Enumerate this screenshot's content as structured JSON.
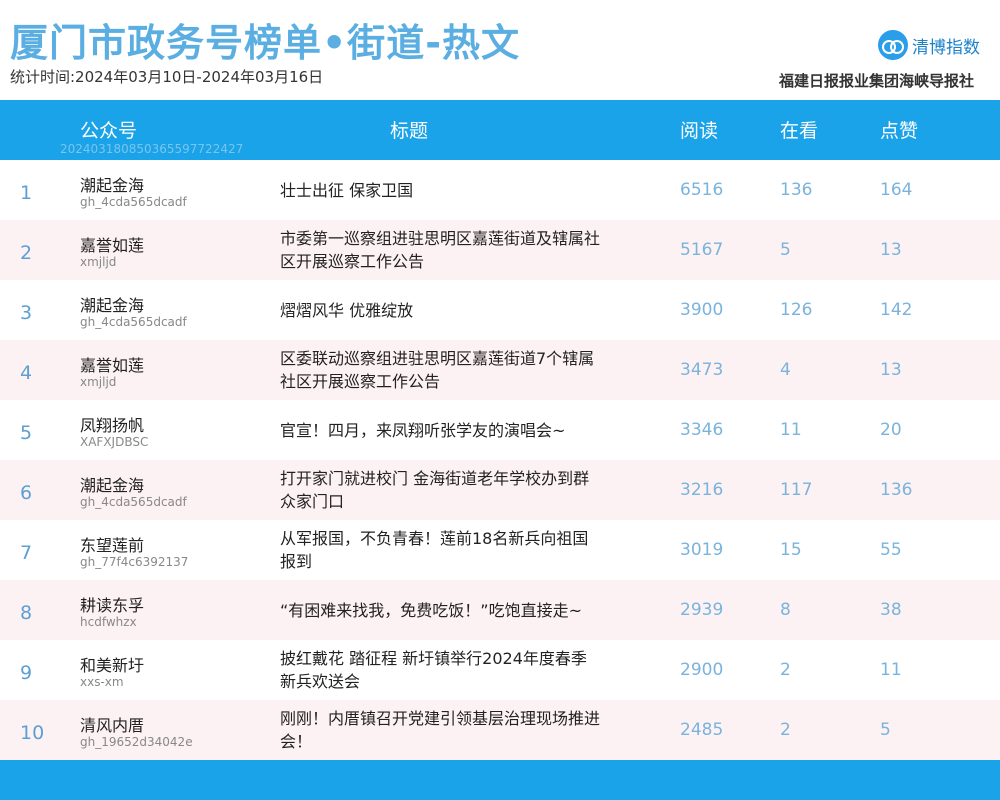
{
  "title": "厦门市政务号榜单•街道-热文",
  "period": "统计时间:2024年03月10日-2024年03月16日",
  "brand": "清博指数",
  "publisher": "福建日报报业集团海峡导报社",
  "header": {
    "account": "公众号",
    "title": "标题",
    "reads": "阅读",
    "looking": "在看",
    "likes": "点赞",
    "watermark": "20240318085036559772242​7"
  },
  "rows": [
    {
      "rank": "1",
      "account": "潮起金海",
      "account_id": "gh_4cda565dcadf",
      "title": "壮士出征 保家卫国",
      "reads": "6516",
      "looking": "136",
      "likes": "164"
    },
    {
      "rank": "2",
      "account": "嘉誉如莲",
      "account_id": "xmjljd",
      "title": "市委第一巡察组进驻思明区嘉莲街道及辖属社区开展巡察工作公告",
      "reads": "5167",
      "looking": "5",
      "likes": "13"
    },
    {
      "rank": "3",
      "account": "潮起金海",
      "account_id": "gh_4cda565dcadf",
      "title": "熠熠风华 优雅绽放",
      "reads": "3900",
      "looking": "126",
      "likes": "142"
    },
    {
      "rank": "4",
      "account": "嘉誉如莲",
      "account_id": "xmjljd",
      "title": "区委联动巡察组进驻思明区嘉莲街道7个辖属社区开展巡察工作公告",
      "reads": "3473",
      "looking": "4",
      "likes": "13"
    },
    {
      "rank": "5",
      "account": "凤翔扬帆",
      "account_id": "XAFXJDBSC",
      "title": "官宣！四月，来凤翔听张学友的演唱会~",
      "reads": "3346",
      "looking": "11",
      "likes": "20"
    },
    {
      "rank": "6",
      "account": "潮起金海",
      "account_id": "gh_4cda565dcadf",
      "title": "打开家门就进校门 金海街道老年学校办到群众家门口",
      "reads": "3216",
      "looking": "117",
      "likes": "136"
    },
    {
      "rank": "7",
      "account": "东望莲前",
      "account_id": "gh_77f4c6392137",
      "title": "从军报国，不负青春！莲前18名新兵向祖国报到",
      "reads": "3019",
      "looking": "15",
      "likes": "55"
    },
    {
      "rank": "8",
      "account": "耕读东孚",
      "account_id": "hcdfwhzx",
      "title": "“有困难来找我，免费吃饭！”吃饱直接走~",
      "reads": "2939",
      "looking": "8",
      "likes": "38"
    },
    {
      "rank": "9",
      "account": "和美新圩",
      "account_id": "xxs-xm",
      "title": "披红戴花 踏征程 新圩镇举行2024年度春季新兵欢送会",
      "reads": "2900",
      "looking": "2",
      "likes": "11"
    },
    {
      "rank": "10",
      "account": "清风内厝",
      "account_id": "gh_19652d34042e",
      "title": "刚刚！内厝镇召开党建引领基层治理现场推进会！",
      "reads": "2485",
      "looking": "2",
      "likes": "5"
    }
  ]
}
